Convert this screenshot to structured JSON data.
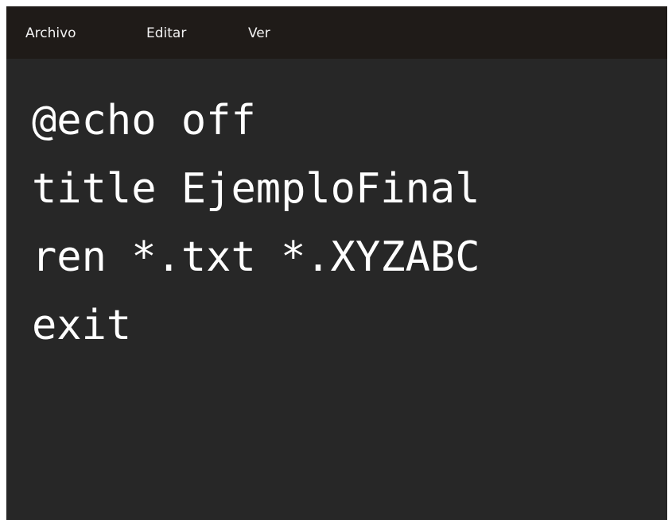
{
  "menu": {
    "items": [
      {
        "label": "Archivo"
      },
      {
        "label": "Editar"
      },
      {
        "label": "Ver"
      }
    ]
  },
  "editor": {
    "lines": [
      "@echo off",
      "title EjemploFinal",
      "ren *.txt *.XYZABC",
      "exit"
    ]
  },
  "colors": {
    "menubar_bg": "#1f1b18",
    "editor_bg": "#272727",
    "text": "#ffffff"
  }
}
